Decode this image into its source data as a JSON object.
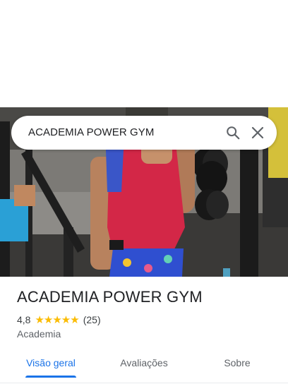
{
  "search": {
    "query": "ACADEMIA POWER GYM"
  },
  "icons": {
    "search": "search-icon",
    "close": "close-icon"
  },
  "place": {
    "name": "ACADEMIA POWER GYM",
    "rating": "4,8",
    "stars": "★★★★★",
    "review_count": "(25)",
    "category": "Academia"
  },
  "tabs": [
    {
      "label": "Visão geral",
      "active": true
    },
    {
      "label": "Avaliações",
      "active": false
    },
    {
      "label": "Sobre",
      "active": false
    }
  ],
  "colors": {
    "accent": "#1a73e8",
    "star": "#fbbc04",
    "text_primary": "#202124",
    "text_secondary": "#5f6368"
  }
}
